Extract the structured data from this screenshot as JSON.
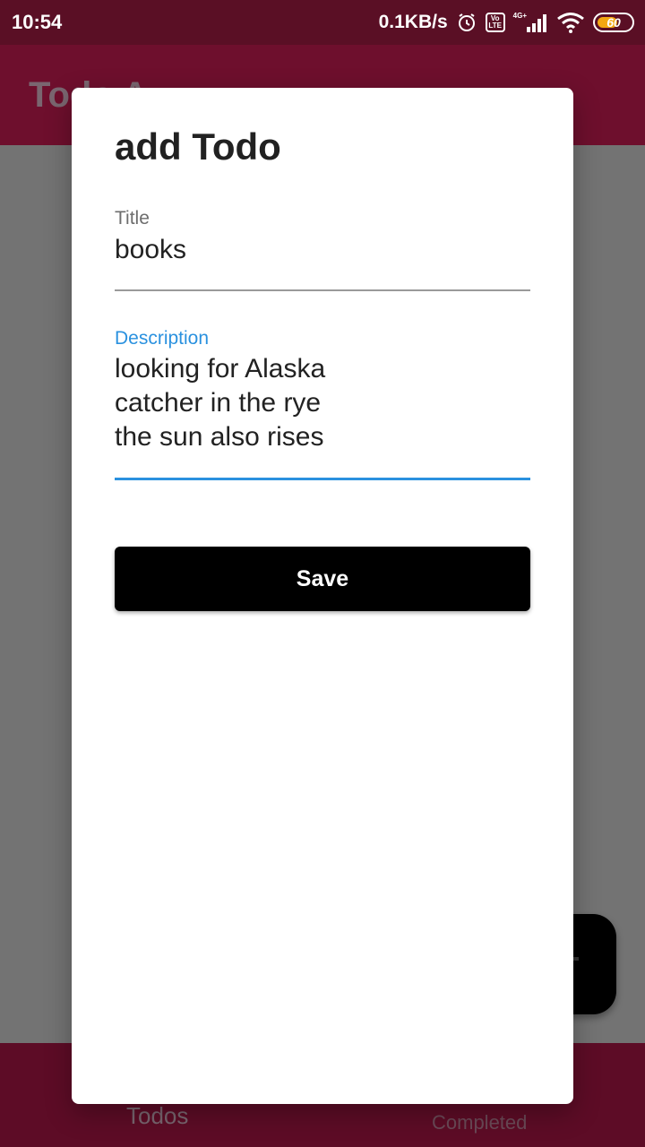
{
  "status_bar": {
    "time": "10:54",
    "net_speed": "0.1KB/s",
    "volte_label": "Vo LTE",
    "network_type": "4G+",
    "battery_level": "60",
    "battery_fraction": 0.6
  },
  "app": {
    "title": "Todo A",
    "bottom_nav": {
      "todos_label": "Todos",
      "completed_label": "Completed"
    },
    "colors": {
      "app_bar": "#6e0f2d",
      "status_bar": "#5a0f25",
      "scrim": "#737373"
    }
  },
  "dialog": {
    "title": "add Todo",
    "title_field": {
      "label": "Title",
      "value": "books"
    },
    "description_field": {
      "label": "Description",
      "value": "looking for Alaska\ncatcher in the rye\nthe sun also rises"
    },
    "save_label": "Save",
    "colors": {
      "focus_accent": "#2a91df",
      "button": "#000000"
    }
  }
}
